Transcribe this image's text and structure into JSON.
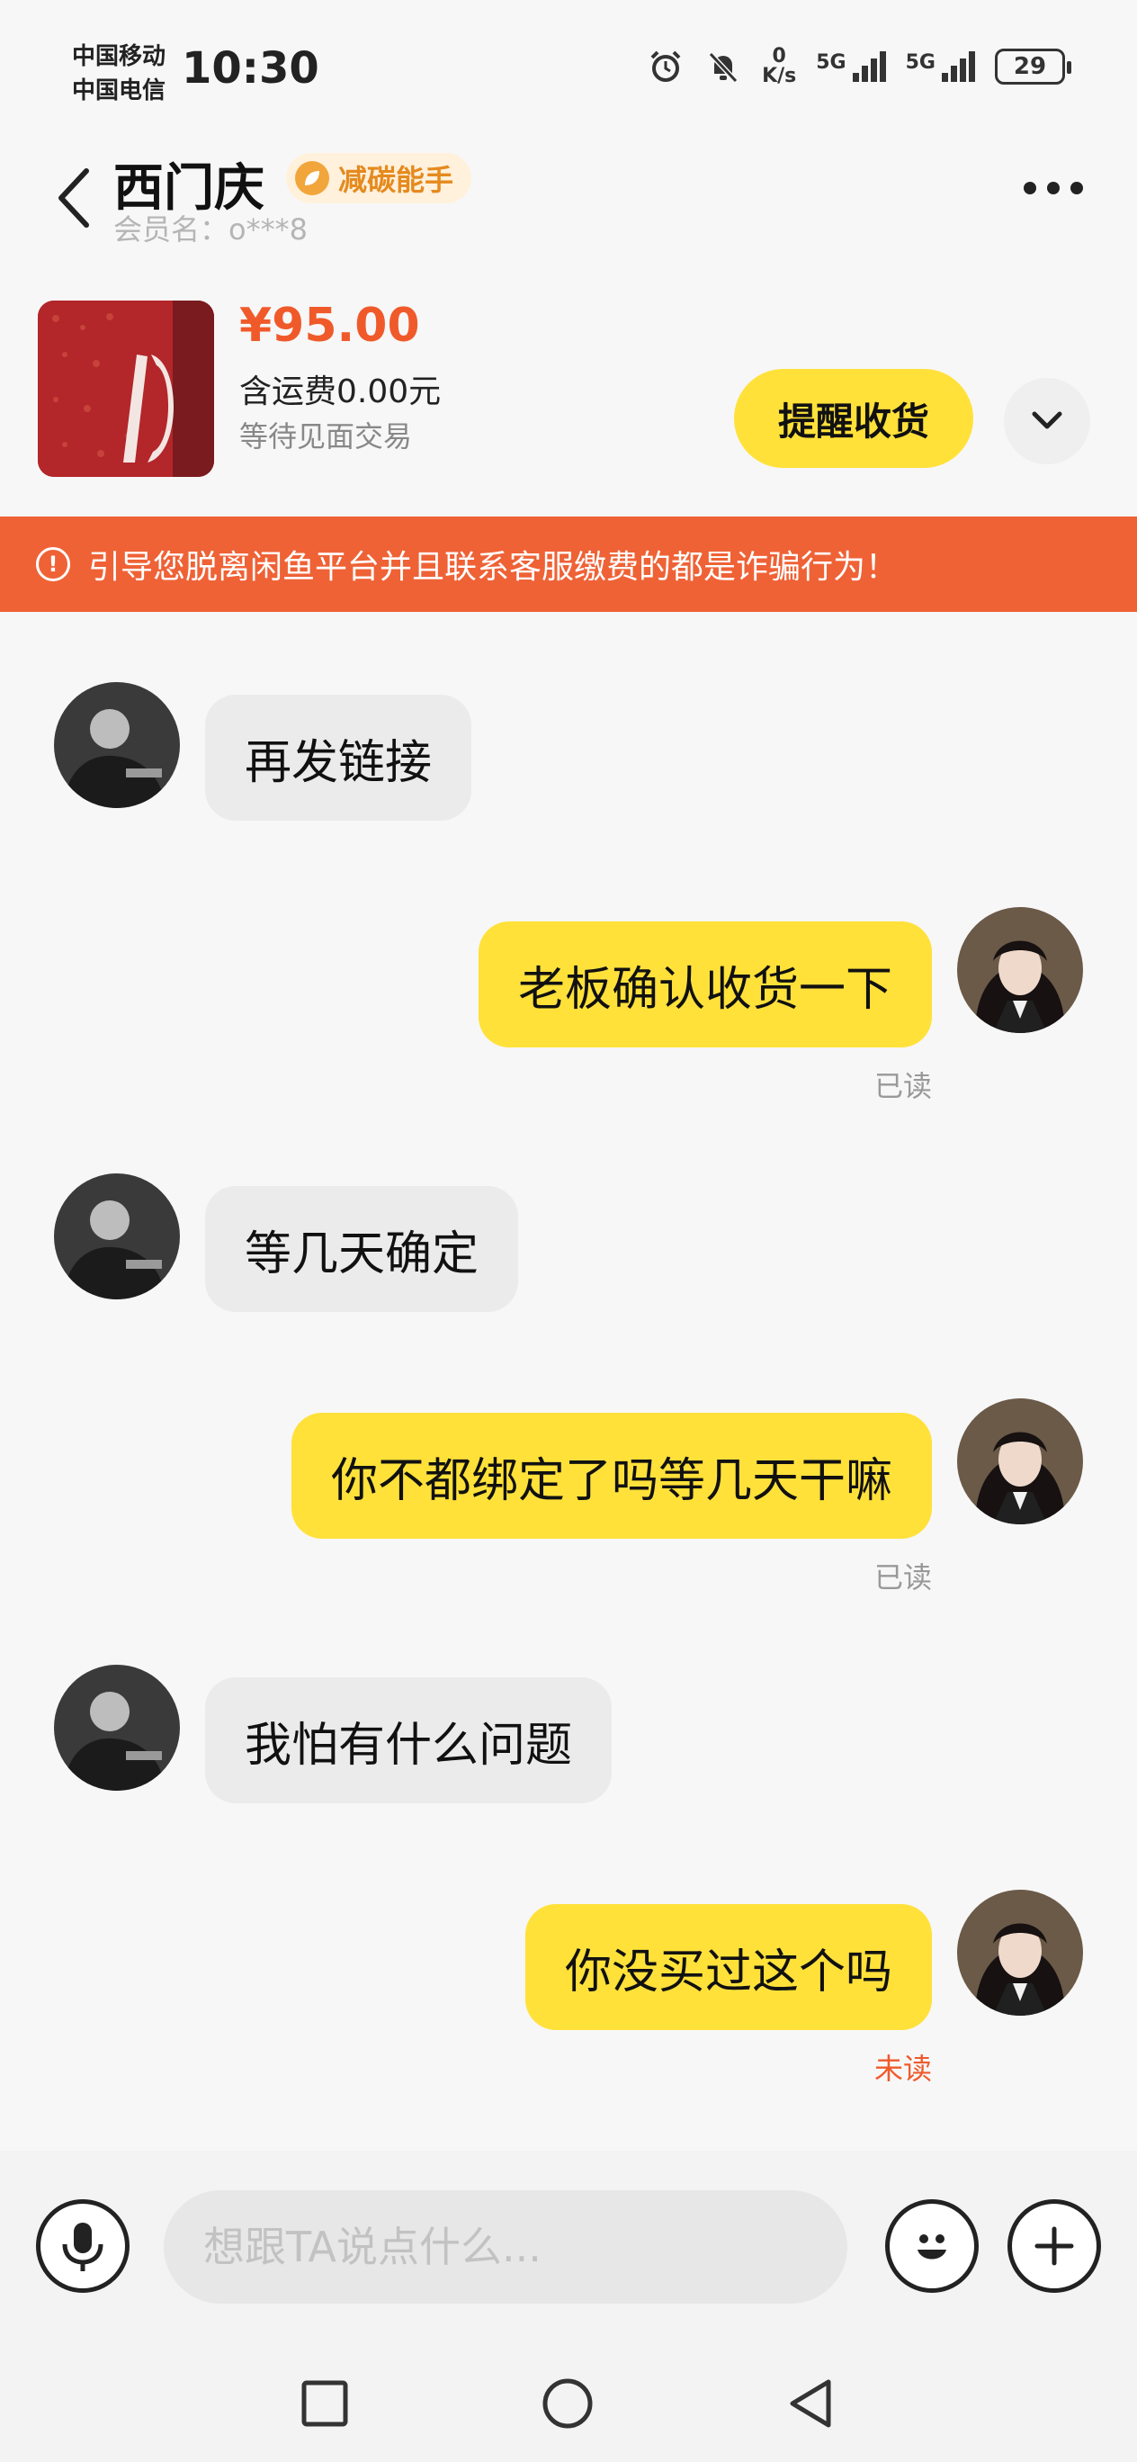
{
  "status_bar": {
    "carrier_1": "中国移动",
    "carrier_2": "中国电信",
    "time": "10:30",
    "net_speed_value": "0",
    "net_speed_unit": "K/s",
    "signal_1": "5G",
    "signal_2": "5G",
    "battery": "29"
  },
  "header": {
    "contact_name": "西门庆",
    "badge": "减碳能手",
    "member_label": "会员名：o***8"
  },
  "product": {
    "price": "¥95.00",
    "shipping": "含运费0.00元",
    "status": "等待见面交易",
    "remind_button": "提醒收货"
  },
  "warning": {
    "text": "引导您脱离闲鱼平台并且联系客服缴费的都是诈骗行为！"
  },
  "messages": [
    {
      "side": "in",
      "text": "再发链接"
    },
    {
      "side": "out",
      "text": "老板确认收货一下",
      "receipt": "已读"
    },
    {
      "side": "in",
      "text": "等几天确定"
    },
    {
      "side": "out",
      "text": "你不都绑定了吗等几天干嘛",
      "receipt": "已读"
    },
    {
      "side": "in",
      "text": "我怕有什么问题"
    },
    {
      "side": "out",
      "text": "你没买过这个吗",
      "receipt": "未读"
    }
  ],
  "input": {
    "placeholder": "想跟TA说点什么..."
  },
  "colors": {
    "accent_yellow": "#ffe13a",
    "warning_orange": "#ef6236",
    "price_red": "#f05a2a",
    "unread_red": "#ef5a2c"
  }
}
